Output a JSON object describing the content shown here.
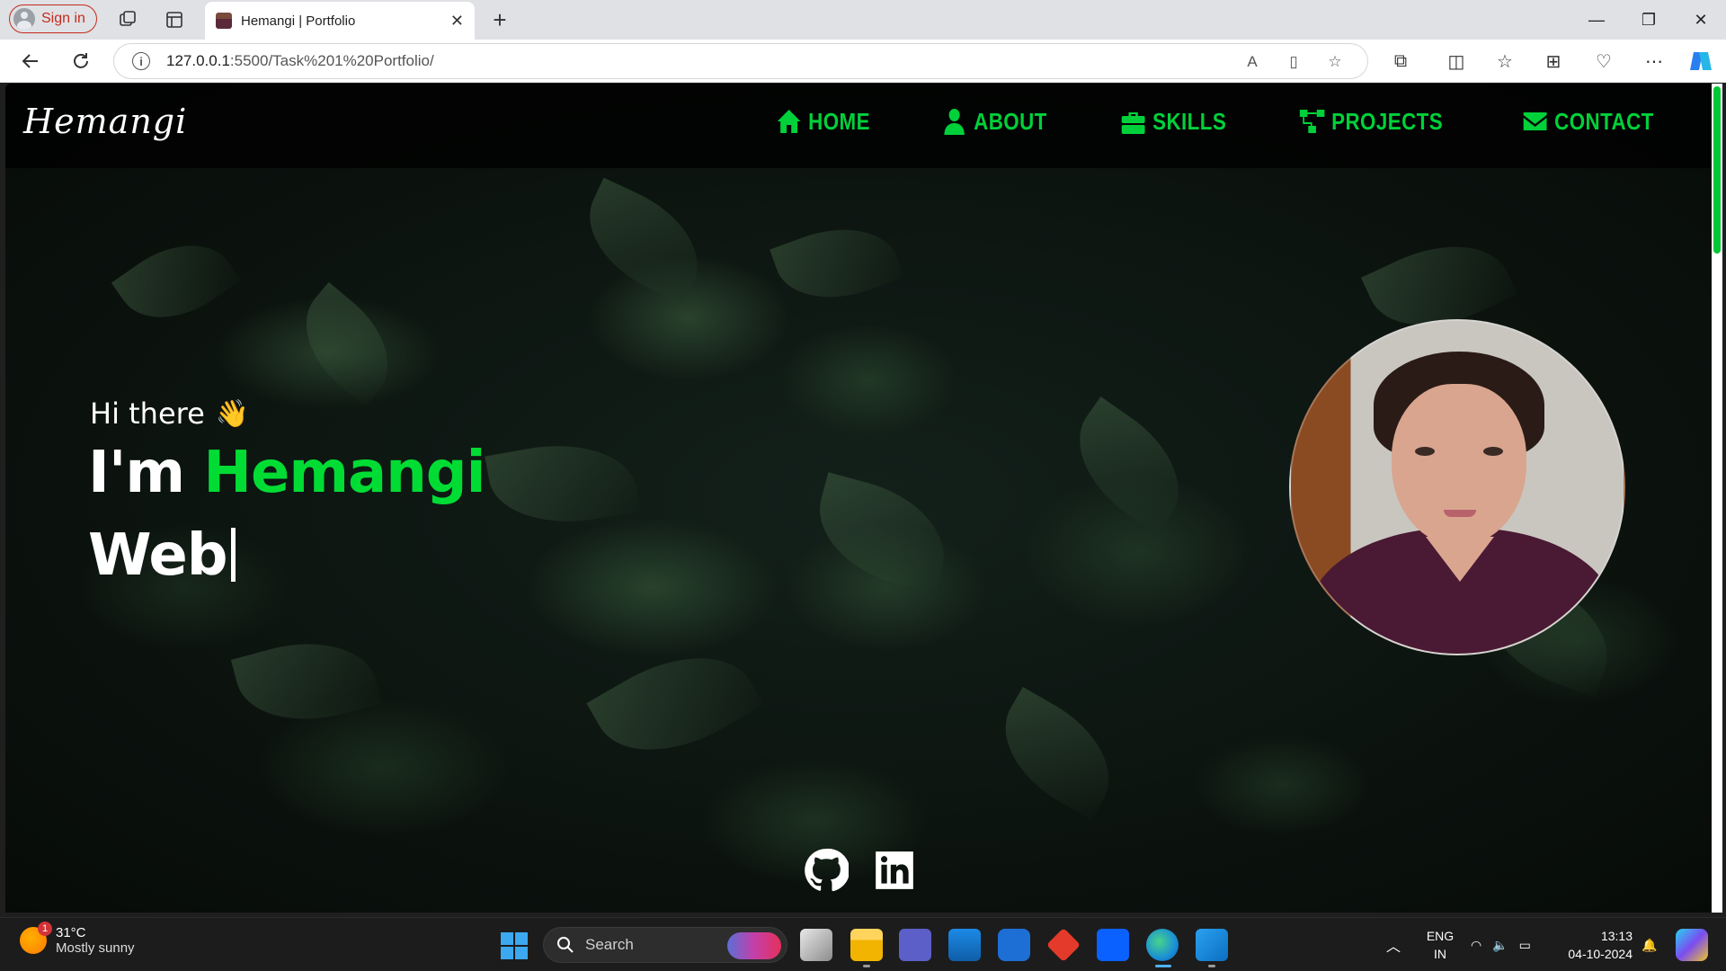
{
  "browser": {
    "signin_label": "Sign in",
    "tab_title": "Hemangi | Portfolio",
    "url_host": "127.0.0.1",
    "url_rest": ":5500/Task%201%20Portfolio/"
  },
  "site": {
    "logo": "Hemangi",
    "nav": [
      {
        "label": "Home",
        "icon": "home-icon"
      },
      {
        "label": "About",
        "icon": "user-icon"
      },
      {
        "label": "Skills",
        "icon": "toolbox-icon"
      },
      {
        "label": "Projects",
        "icon": "project-diagram-icon"
      },
      {
        "label": "Contact",
        "icon": "envelope-icon"
      }
    ],
    "greeting": "Hi there",
    "greeting_emoji": "👋",
    "intro_prefix": "I'm ",
    "intro_name": "Hemangi",
    "typed_text": "Web",
    "accent_color": "#00dc34",
    "socials": [
      "github-icon",
      "linkedin-icon"
    ]
  },
  "taskbar": {
    "weather_temp": "31°C",
    "weather_desc": "Mostly sunny",
    "weather_badge": "1",
    "search_placeholder": "Search",
    "lang_primary": "ENG",
    "lang_secondary": "IN",
    "time": "13:13",
    "date": "04-10-2024"
  }
}
